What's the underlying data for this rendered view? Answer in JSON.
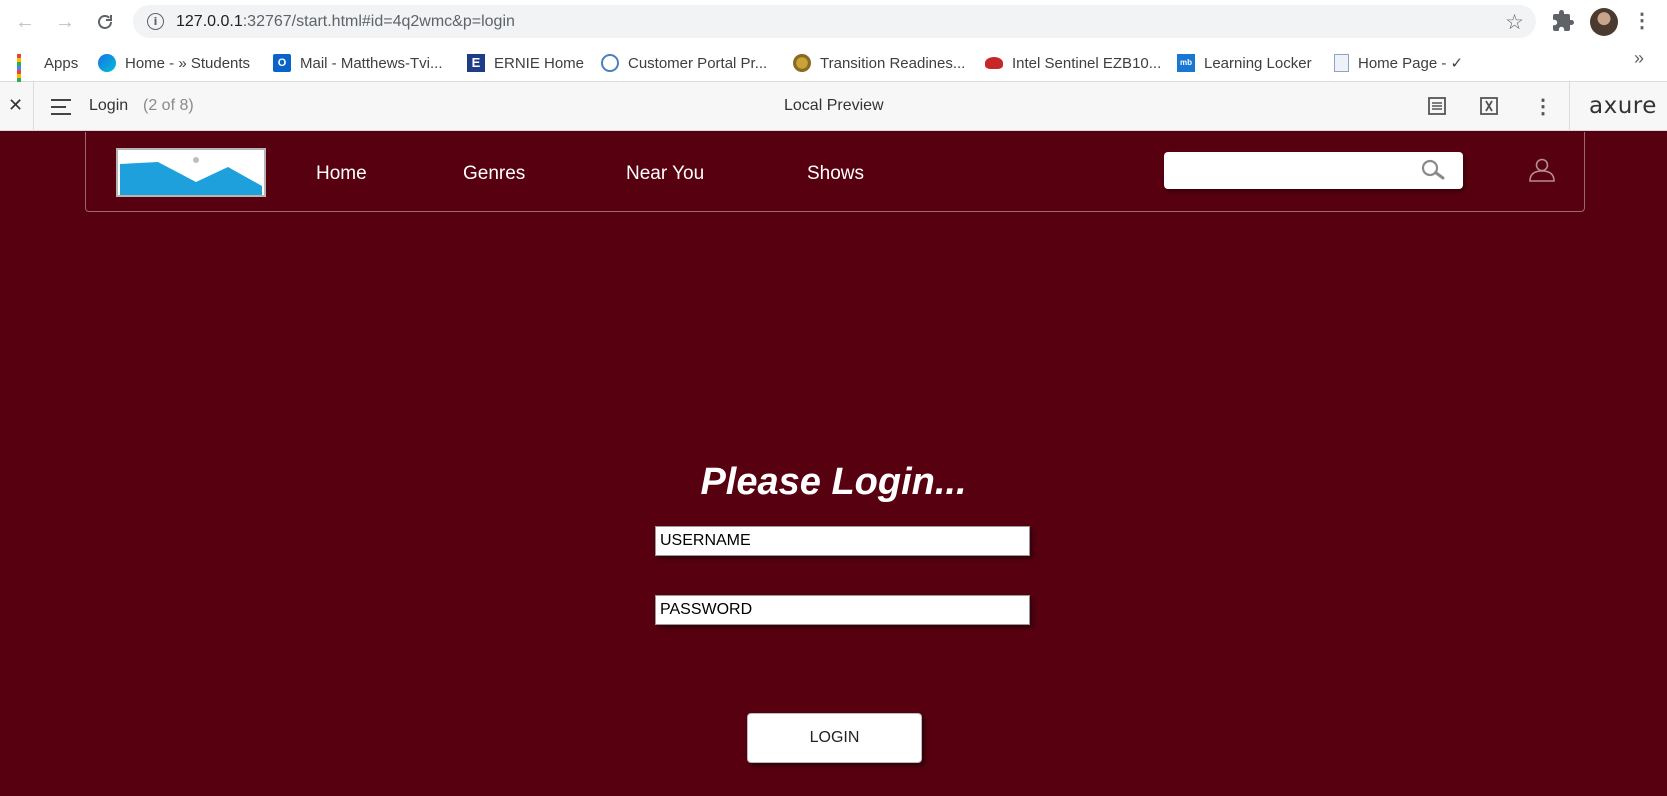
{
  "browser": {
    "url_host": "127.0.0.1",
    "url_rest": ":32767/start.html#id=4q2wmc&p=login",
    "bookmarks": [
      {
        "label": "Apps",
        "icon": "apps-grid-icon"
      },
      {
        "label": "Home - » Students",
        "icon": "students-site-icon"
      },
      {
        "label": "Mail - Matthews-Tvi...",
        "icon": "outlook-icon"
      },
      {
        "label": "ERNIE Home",
        "icon": "ernie-icon"
      },
      {
        "label": "Customer Portal Pr...",
        "icon": "portal-icon"
      },
      {
        "label": "Transition Readines...",
        "icon": "usmc-emblem-icon"
      },
      {
        "label": "Intel Sentinel EZB10...",
        "icon": "sentinel-icon"
      },
      {
        "label": "Learning Locker",
        "icon": "learning-locker-icon"
      },
      {
        "label": "Home Page - ✓",
        "icon": "doc-page-icon"
      }
    ],
    "more_bookmarks": "»"
  },
  "axure": {
    "page_name": "Login",
    "page_count": "(2 of 8)",
    "title": "Local Preview",
    "logo": "axure"
  },
  "site": {
    "nav": [
      "Home",
      "Genres",
      "Near You",
      "Shows"
    ],
    "search_placeholder": "",
    "colors": {
      "background": "#570010",
      "logo_fill": "#1ea0dc"
    }
  },
  "login": {
    "title": "Please Login...",
    "username_placeholder": "USERNAME",
    "password_placeholder": "PASSWORD",
    "button_label": "LOGIN"
  }
}
